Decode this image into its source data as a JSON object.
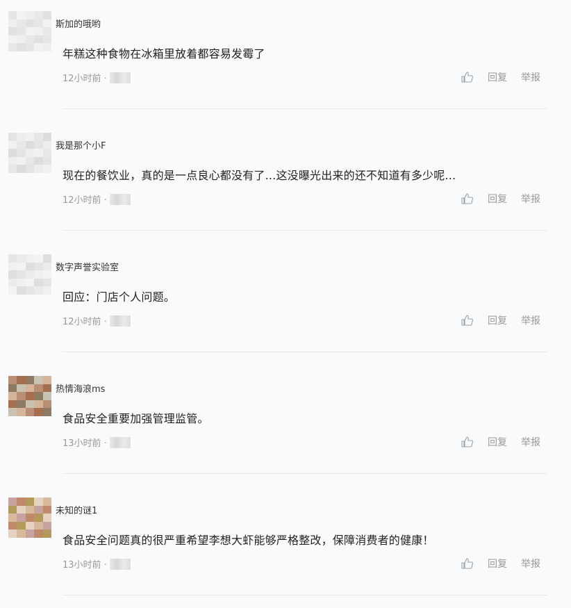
{
  "comments": [
    {
      "username": "斯加的哦哟",
      "content": "年糕这种食物在冰箱里放着都容易发霉了",
      "time": "12小时前 ·",
      "palette": [
        "#e4e6e8",
        "#eeeff0",
        "#dfe1e3",
        "#f1f2f3",
        "#e7e8ea"
      ]
    },
    {
      "username": "我是那个小F",
      "content": "现在的餐饮业，真的是一点良心都没有了...这没曝光出来的还不知道有多少呢...",
      "time": "12小时前 ·",
      "palette": [
        "#e2e4e6",
        "#f0f1f2",
        "#dadcde",
        "#ecedef",
        "#e5e7e9"
      ]
    },
    {
      "username": "数字声誉实验室",
      "content": "回应：门店个人问题。",
      "time": "12小时前 ·",
      "palette": [
        "#e3e5e7",
        "#eff0f1",
        "#dcdee0",
        "#e9ebec",
        "#f2f3f4"
      ]
    },
    {
      "username": "热情海浪ms",
      "content": "食品安全重要加强管理监管。",
      "time": "13小时前 ·",
      "palette": [
        "#b88f74",
        "#8c7a62",
        "#d6b49a",
        "#a56e4f",
        "#c9c1b2"
      ]
    },
    {
      "username": "未知的谜1",
      "content": "食品安全问题真的很严重希望李想大虾能够严格整改，保障消费者的健康！",
      "time": "13小时前 ·",
      "palette": [
        "#c6a2a0",
        "#b39a5b",
        "#d9b99c",
        "#c08a6a",
        "#e6d2c0"
      ]
    }
  ],
  "actions": {
    "reply": "回复",
    "report": "举报"
  },
  "icons": {
    "like": "thumbs-up-icon"
  }
}
